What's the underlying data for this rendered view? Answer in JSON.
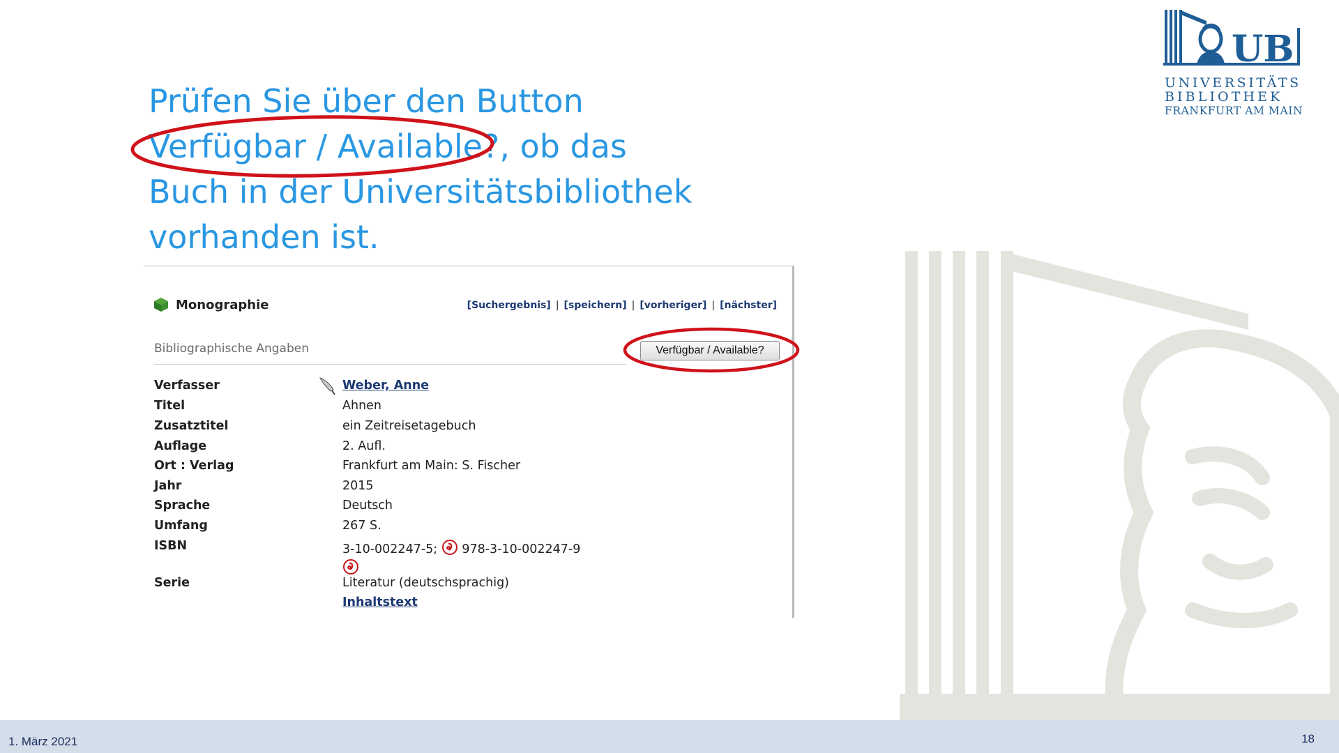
{
  "logo": {
    "initials": "UB",
    "line1": "UNIVERSITÄTS",
    "line2": "BIBLIOTHEK",
    "line3": "FRANKFURT AM MAIN"
  },
  "heading": {
    "lines": [
      "Prüfen Sie über den Button",
      "Verfügbar / Available?, ob das",
      "Buch in der Universitätsbibliothek",
      "vorhanden ist."
    ]
  },
  "record": {
    "type_label": "Monographie",
    "nav": [
      "[Suchergebnis]",
      "[speichern]",
      "[vorheriger]",
      "[nächster]"
    ],
    "section_title": "Bibliographische Angaben",
    "availability_button": "Verfügbar / Available?",
    "fields": {
      "author": {
        "label": "Verfasser",
        "value": "Weber, Anne"
      },
      "title": {
        "label": "Titel",
        "value": "Ahnen"
      },
      "subtitle": {
        "label": "Zusatztitel",
        "value": "ein Zeitreisetagebuch"
      },
      "edition": {
        "label": "Auflage",
        "value": "2. Aufl."
      },
      "place_publisher": {
        "label": "Ort : Verlag",
        "value": "Frankfurt am Main: S. Fischer"
      },
      "year": {
        "label": "Jahr",
        "value": "2015"
      },
      "language": {
        "label": "Sprache",
        "value": "Deutsch"
      },
      "extent": {
        "label": "Umfang",
        "value": "267 S."
      },
      "isbn": {
        "label": "ISBN",
        "value1": "3-10-002247-5;",
        "value2": "978-3-10-002247-9"
      },
      "series": {
        "label": "Serie",
        "value": "Literatur (deutschsprachig)",
        "link": "Inhaltstext"
      }
    }
  },
  "footer": {
    "date": "1. März 2021",
    "page": "18"
  },
  "colors": {
    "heading": "#2a97e2",
    "logo": "#1e5d96",
    "highlight": "#d0121b",
    "footer_bg": "#d3deea"
  }
}
